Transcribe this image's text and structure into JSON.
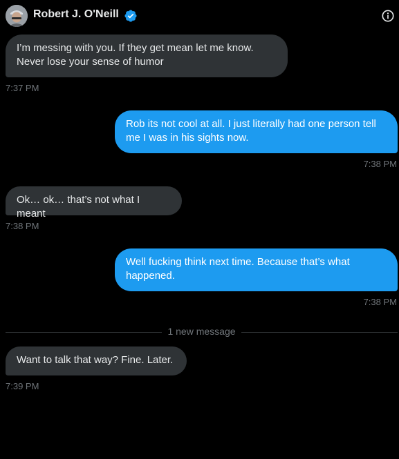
{
  "header": {
    "name": "Robert J. O'Neill",
    "verified_color": "#1d9bf0"
  },
  "messages": [
    {
      "direction": "incoming",
      "text": "I’m messing with you. If they get mean let me know.\nNever lose your sense of humor",
      "time": "7:37 PM"
    },
    {
      "direction": "outgoing",
      "text": "Rob its not cool at all. I just literally had one person tell\nme I was in his sights now.",
      "time": "7:38 PM"
    },
    {
      "direction": "incoming",
      "text": "Ok… ok… that’s not what I meant",
      "time": "7:38 PM"
    },
    {
      "direction": "outgoing",
      "text": "Well fucking think next time. Because that’s what\nhappened.",
      "time": "7:38 PM"
    },
    {
      "direction": "incoming",
      "text": "Want to talk that way? Fine. Later.",
      "time": "7:39 PM"
    }
  ],
  "divider": {
    "label": "1 new message"
  },
  "colors": {
    "background": "#000000",
    "incoming_bubble": "#2f3336",
    "outgoing_bubble": "#1d9bf0",
    "timestamp": "#71767b"
  },
  "icons": {
    "verified": "verified-badge-icon",
    "info": "info-icon"
  }
}
